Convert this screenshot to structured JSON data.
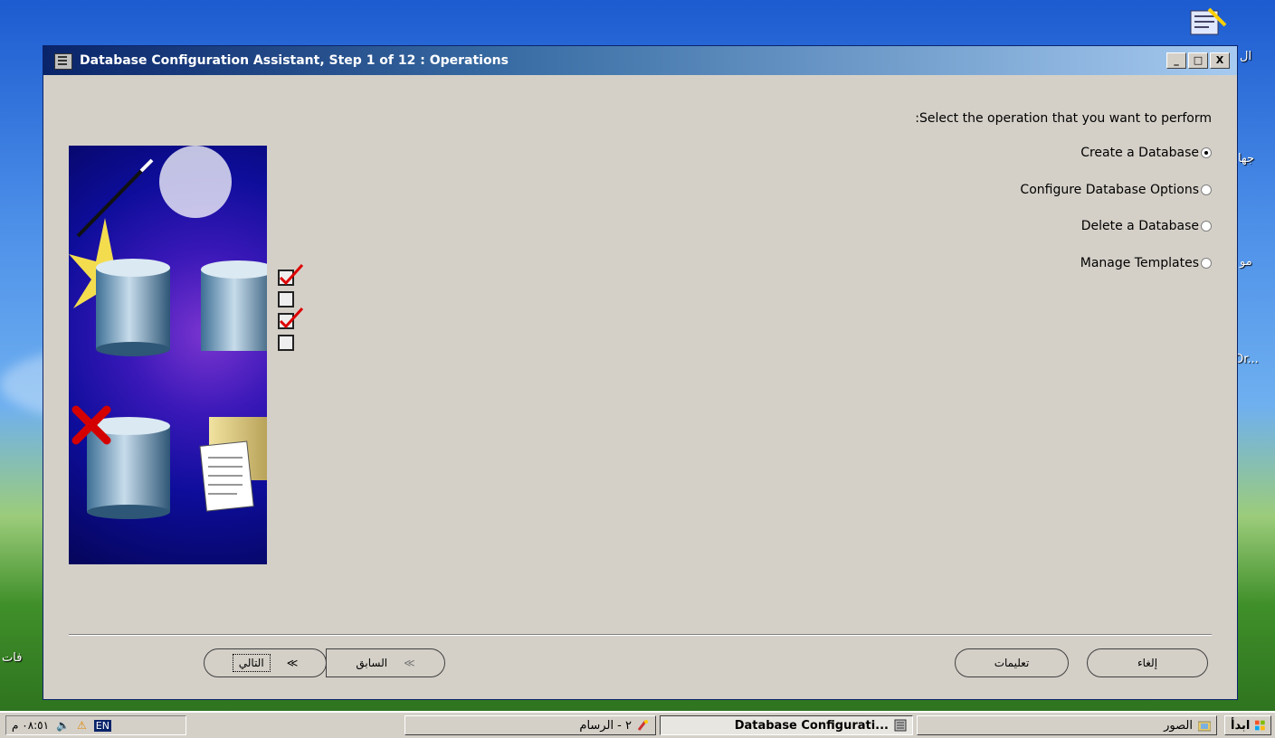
{
  "desktop": {
    "labels": [
      "ال",
      "جها",
      "مو",
      "Or...",
      "فات"
    ]
  },
  "window": {
    "title": "Database Configuration Assistant, Step 1 of 12 : Operations",
    "controls": {
      "minimize": "_",
      "maximize": "□",
      "close": "X"
    },
    "prompt": ":Select the operation that you want to perform",
    "options": [
      {
        "label": "Create a Database",
        "selected": true
      },
      {
        "label": "Configure Database Options",
        "selected": false
      },
      {
        "label": "Delete a Database",
        "selected": false
      },
      {
        "label": "Manage Templates",
        "selected": false
      }
    ],
    "buttons": {
      "next": "التالي",
      "back": "السابق",
      "help": "تعليمات",
      "cancel": "إلغاء"
    }
  },
  "taskbar": {
    "start": "ابدأ",
    "items": [
      {
        "label": "الصور",
        "icon": "pictures-folder-icon"
      },
      {
        "label": "Database Configurati...",
        "icon": "database-app-icon",
        "active": true
      },
      {
        "label": "٢ - الرسام",
        "icon": "paint-icon"
      }
    ],
    "tray": {
      "language": "EN",
      "clock": "٠٨:٥١ م"
    }
  }
}
